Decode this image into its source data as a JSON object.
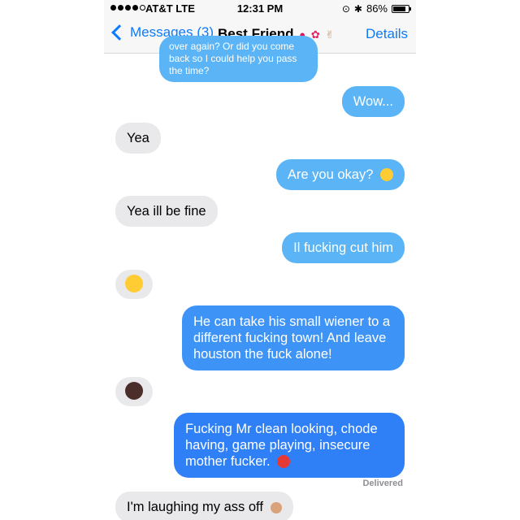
{
  "status_bar": {
    "carrier": "AT&T  LTE",
    "time": "12:31 PM",
    "battery": "86%",
    "battery_level": 0.86
  },
  "nav": {
    "back_label": "Messages (3)",
    "title": "Best Friend",
    "title_emojis": [
      "lips-emoji",
      "hibiscus-emoji",
      "victory-hand-emoji"
    ],
    "details_label": "Details"
  },
  "messages": [
    {
      "from": "friend",
      "text": "over again? Or did you come back so I could help you pass the time?"
    },
    {
      "from": "me",
      "text": "Wow..."
    },
    {
      "from": "friend",
      "text": "Yea"
    },
    {
      "from": "me",
      "text": "Are you okay?",
      "emoji": "confused-face-emoji"
    },
    {
      "from": "friend",
      "text": "Yea ill be fine"
    },
    {
      "from": "me",
      "text": "Il fucking cut him"
    },
    {
      "from": "friend",
      "text": "",
      "emoji": "tears-of-joy-emoji"
    },
    {
      "from": "me",
      "text": "He can take his small wiener to a different fucking town! And leave houston the fuck alone!"
    },
    {
      "from": "friend",
      "text": "",
      "emoji": "facepalm-woman-emoji"
    },
    {
      "from": "me",
      "text": "Fucking Mr clean looking, chode having, game playing, insecure mother fucker.",
      "emoji": "angry-face-emoji"
    },
    {
      "from": "friend",
      "text": "I'm laughing my ass off",
      "emoji": "ok-hand-emoji"
    }
  ],
  "delivered_label": "Delivered",
  "colors": {
    "ios_blue": "#0a7aff",
    "out_bubble_light": "#5ab4f5",
    "out_bubble_dark": "#2f7ff7",
    "in_bubble": "#e9e9eb"
  }
}
